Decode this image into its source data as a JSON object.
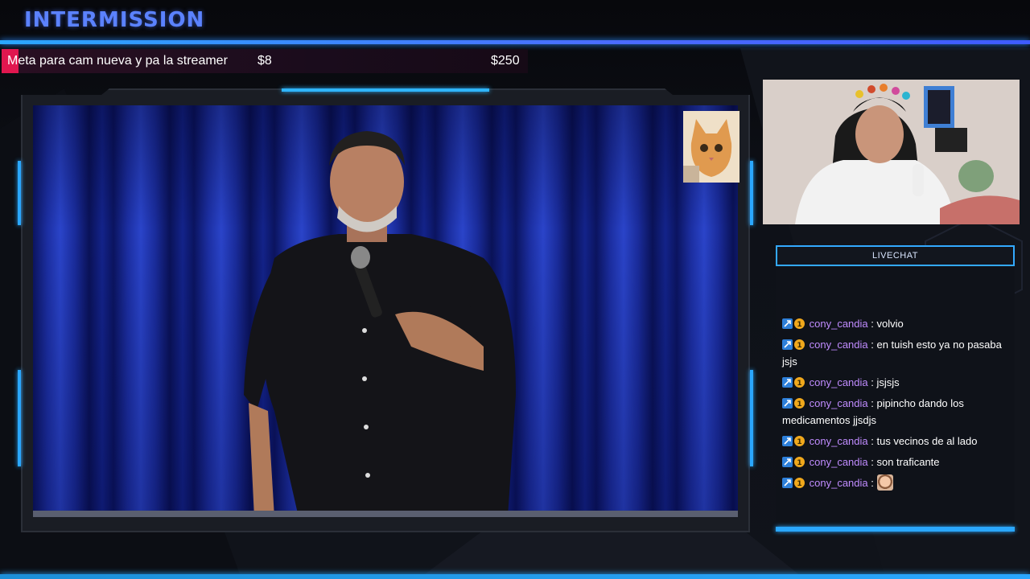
{
  "header": {
    "title": "INTERMISSION"
  },
  "goal": {
    "label": "Meta para cam nueva y pa la streamer",
    "current": "$8",
    "target": "$250",
    "progress": 0.032
  },
  "chat": {
    "header": "LIVECHAT",
    "messages": [
      {
        "user": "cony_candia",
        "text": ": volvio"
      },
      {
        "user": "cony_candia",
        "text": ": en tuish esto ya no pasaba jsjs"
      },
      {
        "user": "cony_candia",
        "text": ": jsjsjs"
      },
      {
        "user": "cony_candia",
        "text": ": pipincho dando los medicamentos jjsdjs"
      },
      {
        "user": "cony_candia",
        "text": ": tus vecinos de al lado"
      },
      {
        "user": "cony_candia",
        "text": ": son traficante"
      },
      {
        "user": "cony_candia",
        "text": ":",
        "emote": "emote-icon"
      }
    ]
  },
  "colors": {
    "accent": "#2aa7ff",
    "title": "#5b82ff",
    "goal_fill": "#e0174f",
    "username": "#c08cff"
  }
}
